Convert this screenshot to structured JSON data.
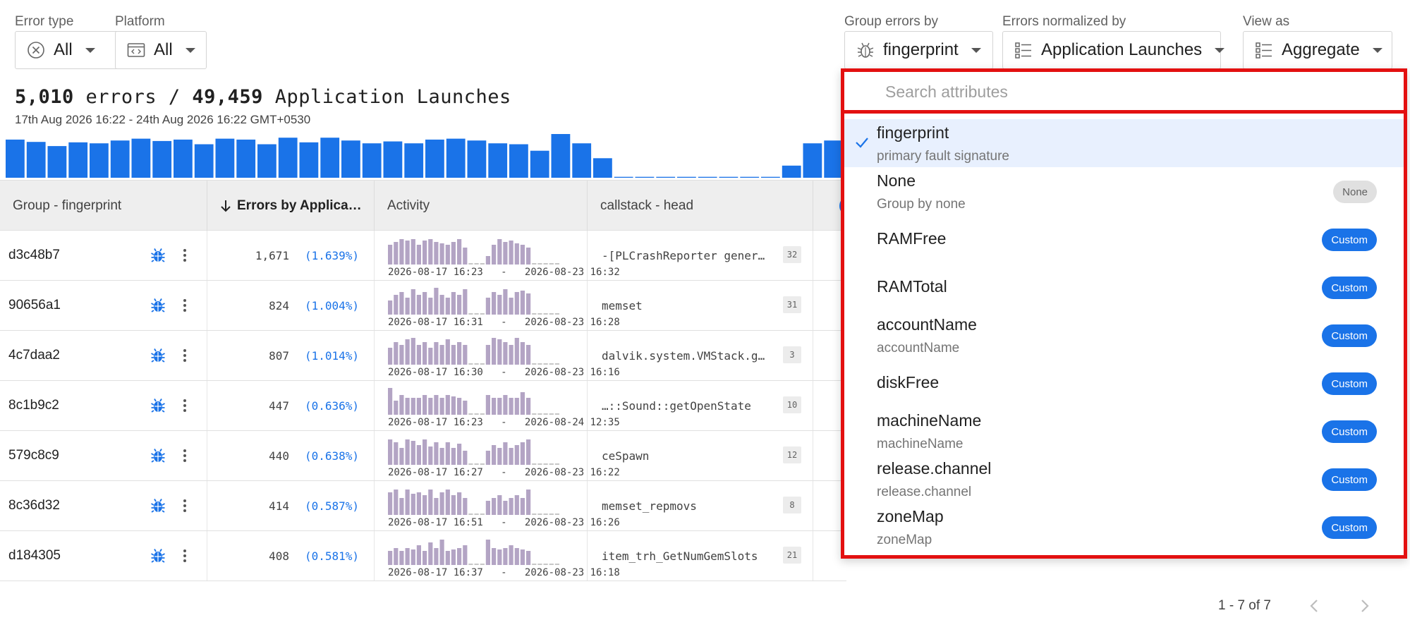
{
  "filters": {
    "error_type": {
      "label": "Error type",
      "value": "All"
    },
    "platform": {
      "label": "Platform",
      "value": "All"
    },
    "group_by": {
      "label": "Group errors by",
      "value": "fingerprint"
    },
    "normalized_by": {
      "label": "Errors normalized by",
      "value": "Application Launches"
    },
    "view_as": {
      "label": "View as",
      "value": "Aggregate"
    }
  },
  "summary": {
    "errors": "5,010",
    "errors_word": "errors",
    "sep": "/",
    "launches": "49,459",
    "launches_word": "Application Launches",
    "date_range": "17th Aug 2026 16:22 - 24th Aug 2026 16:22 GMT+0530"
  },
  "histogram": {
    "values": [
      0.82,
      0.77,
      0.68,
      0.76,
      0.74,
      0.8,
      0.84,
      0.79,
      0.82,
      0.72,
      0.84,
      0.82,
      0.72,
      0.86,
      0.76,
      0.86,
      0.8,
      0.74,
      0.78,
      0.74,
      0.82,
      0.84,
      0.8,
      0.74,
      0.72,
      0.58,
      0.94,
      0.74,
      0.42,
      0.02,
      0.02,
      0.02,
      0.02,
      0.02,
      0.02,
      0.02,
      0.02,
      0.26,
      0.74,
      0.8
    ],
    "color": "#1a73e8"
  },
  "table": {
    "headers": {
      "group": "Group - fingerprint",
      "errors": "Errors by Applica…",
      "activity": "Activity",
      "callstack": "callstack - head"
    },
    "rows": [
      {
        "id": "d3c48b7",
        "count": "1,671",
        "pct": "(1.639%)",
        "start": "2026-08-17 16:23",
        "end": "2026-08-23 16:32",
        "stack": "-[PLCrashReporter genera…",
        "badge": "32",
        "spark": [
          0.7,
          0.8,
          0.9,
          0.85,
          0.9,
          0.7,
          0.85,
          0.9,
          0.8,
          0.75,
          0.7,
          0.8,
          0.9,
          0.6,
          0.05,
          0.05,
          0.05,
          0.3,
          0.7,
          0.9,
          0.8,
          0.85,
          0.75,
          0.7,
          0.6,
          0.05,
          0.05,
          0.05,
          0.05,
          0.05
        ]
      },
      {
        "id": "90656a1",
        "count": "824",
        "pct": "(1.004%)",
        "start": "2026-08-17 16:31",
        "end": "2026-08-23 16:28",
        "stack": "memset",
        "badge": "31",
        "spark": [
          0.5,
          0.7,
          0.8,
          0.6,
          0.9,
          0.7,
          0.8,
          0.6,
          0.95,
          0.7,
          0.6,
          0.8,
          0.7,
          0.9,
          0.05,
          0.05,
          0.05,
          0.6,
          0.8,
          0.7,
          0.9,
          0.6,
          0.8,
          0.85,
          0.75,
          0.05,
          0.05,
          0.05,
          0.05,
          0.05
        ]
      },
      {
        "id": "4c7daa2",
        "count": "807",
        "pct": "(1.014%)",
        "start": "2026-08-17 16:30",
        "end": "2026-08-23 16:16",
        "stack": "dalvik.system.VMStack.ge…",
        "badge": "3",
        "spark": [
          0.6,
          0.8,
          0.7,
          0.9,
          0.95,
          0.7,
          0.8,
          0.6,
          0.8,
          0.7,
          0.9,
          0.7,
          0.8,
          0.7,
          0.05,
          0.05,
          0.05,
          0.7,
          0.95,
          0.9,
          0.8,
          0.7,
          0.95,
          0.8,
          0.7,
          0.05,
          0.05,
          0.05,
          0.05,
          0.05
        ]
      },
      {
        "id": "8c1b9c2",
        "count": "447",
        "pct": "(0.636%)",
        "start": "2026-08-17 16:23",
        "end": "2026-08-24 12:35",
        "stack": "…::Sound::getOpenState",
        "badge": "10",
        "spark": [
          0.95,
          0.5,
          0.7,
          0.6,
          0.6,
          0.6,
          0.7,
          0.6,
          0.7,
          0.6,
          0.7,
          0.65,
          0.6,
          0.5,
          0.05,
          0.05,
          0.05,
          0.7,
          0.6,
          0.6,
          0.7,
          0.6,
          0.6,
          0.8,
          0.6,
          0.05,
          0.05,
          0.05,
          0.05,
          0.05
        ]
      },
      {
        "id": "579c8c9",
        "count": "440",
        "pct": "(0.638%)",
        "start": "2026-08-17 16:27",
        "end": "2026-08-23 16:22",
        "stack": "ceSpawn",
        "badge": "12",
        "spark": [
          0.9,
          0.8,
          0.6,
          0.9,
          0.85,
          0.7,
          0.9,
          0.65,
          0.8,
          0.6,
          0.8,
          0.6,
          0.75,
          0.5,
          0.05,
          0.05,
          0.05,
          0.5,
          0.7,
          0.6,
          0.8,
          0.6,
          0.7,
          0.8,
          0.9,
          0.05,
          0.05,
          0.05,
          0.05,
          0.05
        ]
      },
      {
        "id": "8c36d32",
        "count": "414",
        "pct": "(0.587%)",
        "start": "2026-08-17 16:51",
        "end": "2026-08-23 16:26",
        "stack": "memset_repmovs",
        "badge": "8",
        "spark": [
          0.8,
          0.9,
          0.6,
          0.9,
          0.75,
          0.8,
          0.7,
          0.9,
          0.6,
          0.8,
          0.9,
          0.7,
          0.8,
          0.6,
          0.05,
          0.05,
          0.05,
          0.5,
          0.6,
          0.7,
          0.5,
          0.6,
          0.7,
          0.6,
          0.9,
          0.05,
          0.05,
          0.05,
          0.05,
          0.05
        ]
      },
      {
        "id": "d184305",
        "count": "408",
        "pct": "(0.581%)",
        "start": "2026-08-17 16:37",
        "end": "2026-08-23 16:18",
        "stack": "item_trh_GetNumGemSlots",
        "badge": "21",
        "spark": [
          0.5,
          0.6,
          0.5,
          0.6,
          0.55,
          0.7,
          0.5,
          0.8,
          0.6,
          0.9,
          0.5,
          0.55,
          0.6,
          0.7,
          0.05,
          0.05,
          0.05,
          0.9,
          0.6,
          0.55,
          0.6,
          0.7,
          0.6,
          0.55,
          0.5,
          0.05,
          0.05,
          0.05,
          0.05,
          0.05
        ]
      }
    ],
    "spark_color": "#b3a4c4"
  },
  "pagination": {
    "text": "1 - 7 of 7"
  },
  "dropdown": {
    "search_placeholder": "Search attributes",
    "options": [
      {
        "title": "fingerprint",
        "sub": "primary fault signature",
        "badge": "",
        "selected": true
      },
      {
        "title": "None",
        "sub": "Group by none",
        "badge": "None",
        "selected": false
      },
      {
        "title": "RAMFree",
        "sub": "",
        "badge": "Custom",
        "selected": false
      },
      {
        "title": "RAMTotal",
        "sub": "",
        "badge": "Custom",
        "selected": false
      },
      {
        "title": "accountName",
        "sub": "accountName",
        "badge": "Custom",
        "selected": false
      },
      {
        "title": "diskFree",
        "sub": "",
        "badge": "Custom",
        "selected": false
      },
      {
        "title": "machineName",
        "sub": "machineName",
        "badge": "Custom",
        "selected": false
      },
      {
        "title": "release.channel",
        "sub": "release.channel",
        "badge": "Custom",
        "selected": false
      },
      {
        "title": "zoneMap",
        "sub": "zoneMap",
        "badge": "Custom",
        "selected": false
      }
    ]
  },
  "colors": {
    "accent": "#1a73e8",
    "highlight": "#e31010",
    "selected_bg": "#e8f0fe"
  }
}
